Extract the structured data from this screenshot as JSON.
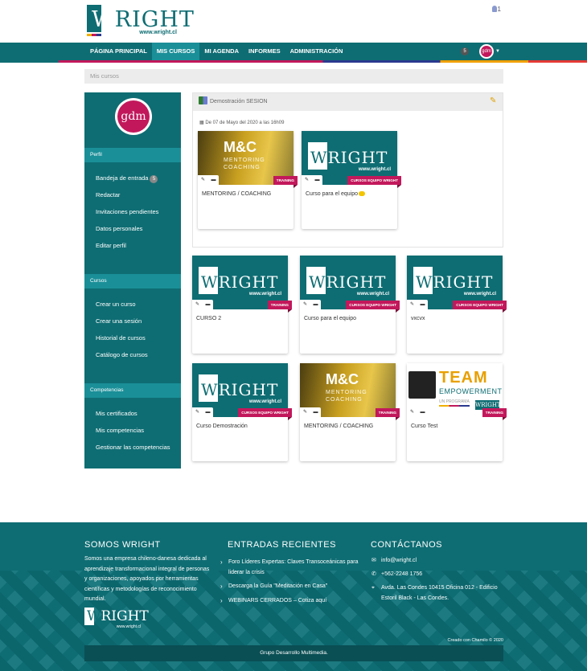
{
  "header": {
    "logo_text": "WRIGHT",
    "logo_url": "www.wright.cl",
    "user_count": "1"
  },
  "nav": {
    "items": [
      "PÁGINA PRINCIPAL",
      "MIS CURSOS",
      "MI AGENDA",
      "INFORMES",
      "ADMINISTRACIÓN"
    ],
    "active": "MIS CURSOS",
    "notifications": "5",
    "avatar": "gdm"
  },
  "breadcrumb": "Mis cursos",
  "sidebar": {
    "avatar": "gdm",
    "sections": [
      {
        "title": "Perfil",
        "items": [
          "Bandeja de entrada",
          "Redactar",
          "Invitaciones pendientes",
          "Datos personales",
          "Editar perfil"
        ]
      },
      {
        "title": "Cursos",
        "items": [
          "Crear un curso",
          "Crear una sesión",
          "Historial de cursos",
          "Catálogo de cursos"
        ]
      },
      {
        "title": "Competencias",
        "items": [
          "Mis certificados",
          "Mis competencias",
          "Gestionar las competencias"
        ]
      }
    ],
    "inbox_badge": "5"
  },
  "session": {
    "title": "Demostración SESION",
    "date": "De 07 de Mayo del 2020 a las 16h09",
    "cards": [
      {
        "thumb": "mc",
        "tag": "TRAINING",
        "title": "MENTORING / COACHING"
      },
      {
        "thumb": "wright",
        "tag": "CURSOS EQUIPO WRIGHT",
        "title": "Curso para el equipo"
      }
    ]
  },
  "courses": [
    {
      "thumb": "wright",
      "tag": "TRAINING",
      "title": "CURSO 2"
    },
    {
      "thumb": "wright",
      "tag": "CURSOS EQUIPO WRIGHT",
      "title": "Curso para el equipo"
    },
    {
      "thumb": "wright",
      "tag": "CURSOS EQUIPO WRIGHT",
      "title": "vxcvx"
    },
    {
      "thumb": "wright",
      "tag": "CURSOS EQUIPO WRIGHT",
      "title": "Curso Demostración"
    },
    {
      "thumb": "mc",
      "tag": "TRAINING",
      "title": "MENTORING / COACHING"
    },
    {
      "thumb": "team",
      "tag": "TRAINING",
      "title": "Curso Test"
    }
  ],
  "thumb_text": {
    "mc_title": "M&C",
    "mc_sub1": "MENTORING",
    "mc_sub2": "COACHING",
    "team_title": "TEAM",
    "team_sub": "EMPOWERMENT",
    "team_prog": "UN PROGRAMA",
    "wright_text": "WRIGHT",
    "wright_url": "www.wright.cl"
  },
  "footer": {
    "about_title": "SOMOS WRIGHT",
    "about_text": "Somos una empresa chileno-danesa dedicada al aprendizaje transformacional integral de personas y organizaciones, apoyados por herramientas científicas y metodologías de reconocimiento mundial.",
    "recent_title": "ENTRADAS RECIENTES",
    "recent": [
      "Foro Líderes Expertas: Claves Transoceánicas para liderar la crisis",
      "Descarga la Guía \"Meditación en Casa\"",
      "WEBINARS CERRADOS – Cotiza aquí"
    ],
    "contact_title": "CONTÁCTANOS",
    "email": "info@wright.cl",
    "phone": "+562-2248 1756",
    "address": "Avda. Las Condes 10415 Oficina 012 - Edificio Estoril Black - Las Condes.",
    "credit": "Creado con Chamilo © 2020",
    "bottom": "Grupo Desarrollo Multimedia."
  },
  "colors": {
    "primary": "#0e6d73",
    "accent": "#c2185b",
    "secondary": "#1a8f98"
  }
}
